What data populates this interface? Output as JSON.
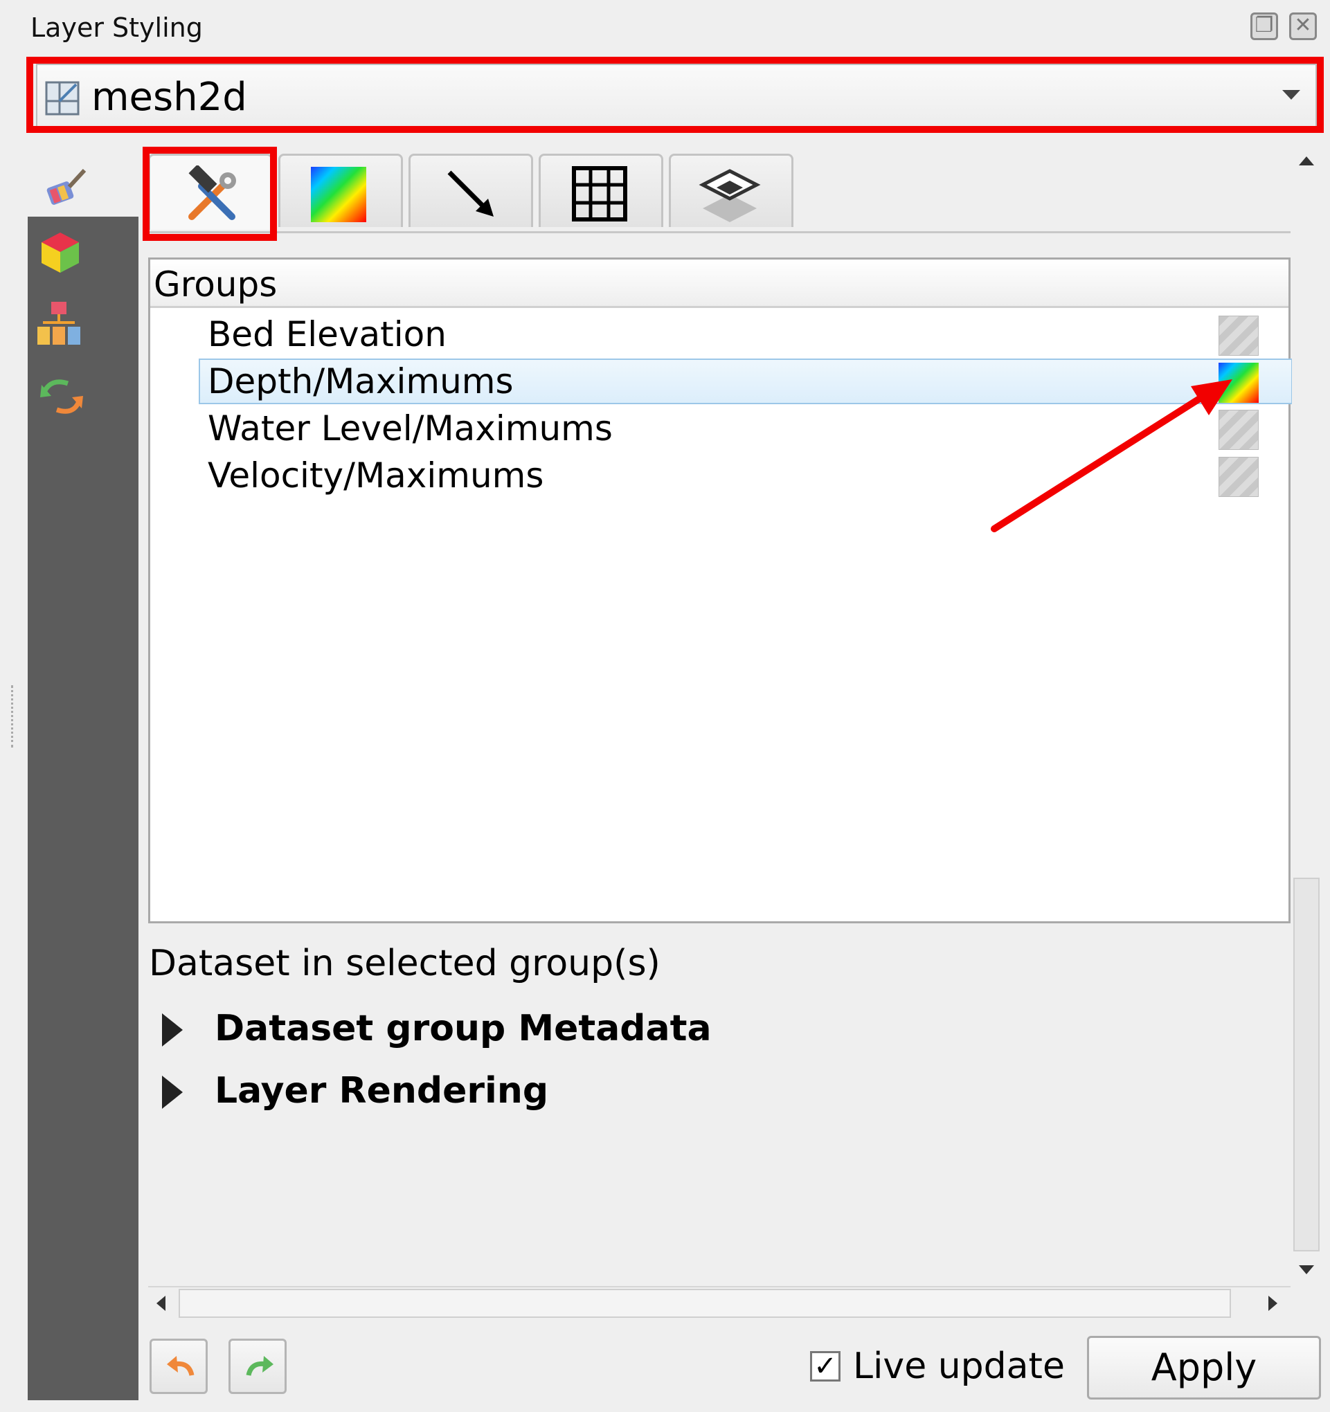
{
  "window": {
    "title": "Layer Styling",
    "float_icon": "restore-icon",
    "close_icon": "close-icon"
  },
  "layer_selector": {
    "value": "mesh2d",
    "icon": "mesh-layer-icon"
  },
  "side_tabs": [
    {
      "name": "symbology",
      "icon": "paintbrush-icon"
    },
    {
      "name": "3d-view",
      "icon": "cube-icon"
    },
    {
      "name": "style-manager",
      "icon": "hierarchy-icon"
    },
    {
      "name": "history",
      "icon": "undo-redo-icon"
    }
  ],
  "tabs": [
    {
      "name": "datasets",
      "icon": "hammer-wrench-icon",
      "active": true
    },
    {
      "name": "contours",
      "icon": "color-ramp-icon"
    },
    {
      "name": "vectors",
      "icon": "arrow-icon"
    },
    {
      "name": "mesh-frame",
      "icon": "grid-icon"
    },
    {
      "name": "rendering",
      "icon": "layers-icon"
    }
  ],
  "groups": {
    "header": "Groups",
    "items": [
      {
        "label": "Bed Elevation",
        "active": false
      },
      {
        "label": "Depth/Maximums",
        "active": true
      },
      {
        "label": "Water Level/Maximums",
        "active": false
      },
      {
        "label": "Velocity/Maximums",
        "active": false
      }
    ]
  },
  "dataset_label": "Dataset in selected group(s)",
  "sections": [
    {
      "label": "Dataset group Metadata"
    },
    {
      "label": "Layer Rendering"
    }
  ],
  "footer": {
    "undo_icon": "undo-icon",
    "redo_icon": "redo-icon",
    "live_update_label": "Live update",
    "live_update_checked": "✓",
    "apply_label": "Apply"
  },
  "colors": {
    "highlight": "#f20000",
    "sidebar": "#5c5c5c",
    "selection": "#dceefb"
  }
}
